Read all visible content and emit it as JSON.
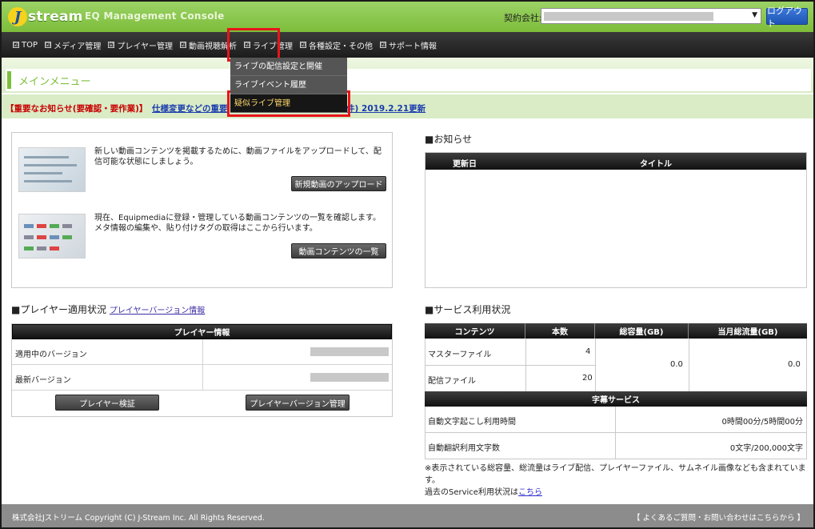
{
  "header": {
    "logo_text": "stream",
    "logo_mark": "J",
    "app_title": "EQ Management Console",
    "contract_label": "契約会社:",
    "contract_arrow": "▼",
    "logout_label": "ログアウト"
  },
  "nav": {
    "items": [
      {
        "label": "TOP"
      },
      {
        "label": "メディア管理"
      },
      {
        "label": "プレイヤー管理"
      },
      {
        "label": "動画視聴解析"
      },
      {
        "label": "ライブ管理"
      },
      {
        "label": "各種設定・その他"
      },
      {
        "label": "サポート情報"
      }
    ],
    "checkbox_glyph": "☑"
  },
  "dropdown": {
    "items": [
      {
        "label": "ライブの配信設定と開催"
      },
      {
        "label": "ライブイベント履歴"
      },
      {
        "label": "疑似ライブ管理"
      }
    ]
  },
  "page": {
    "title": "メインメニュー"
  },
  "notice": {
    "label": "【重要なお知らせ(要確認・要作業)】",
    "link": "仕様変更などの重要",
    "link_tail": "ます。(6件) 2019.2.21更新"
  },
  "upload": {
    "text1": "新しい動画コンテンツを掲載するために、動画ファイルをアップロードして、配信可能な状態にしましょう。",
    "button1": "新規動画のアップロード",
    "text2": "現在、Equipmediaに登録・管理している動画コンテンツの一覧を確認します。メタ情報の編集や、貼り付けタグの取得はここから行います。",
    "button2": "動画コンテンツの一覧"
  },
  "player": {
    "heading": "■プレイヤー適用状況",
    "heading_link": "プレイヤーバージョン情報",
    "table_head": "プレイヤー情報",
    "row1": "適用中のバージョン",
    "row2": "最新バージョン",
    "verify_button": "プレイヤー検証",
    "manage_button": "プレイヤーバージョン管理"
  },
  "news": {
    "heading": "■お知らせ",
    "col_date": "更新日",
    "col_title": "タイトル"
  },
  "service": {
    "heading": "■サービス利用状況",
    "cols": [
      "コンテンツ",
      "本数",
      "総容量(GB)",
      "当月総流量(GB)"
    ],
    "rows": [
      {
        "label": "マスターファイル",
        "count": "4"
      },
      {
        "label": "配信ファイル",
        "count": "20"
      }
    ],
    "total_capacity": "0.0",
    "monthly_traffic": "0.0",
    "caption_head": "字幕サービス",
    "caption_rows": [
      {
        "label": "自動文字起こし利用時間",
        "value": "0時間00分/5時間00分"
      },
      {
        "label": "自動翻訳利用文字数",
        "value": "0文字/200,000文字"
      }
    ],
    "note1": "※表示されている総容量、総流量はライブ配信、プレイヤーファイル、サムネイル画像なども含まれています。",
    "note2": "過去のService利用状況は",
    "note_link": "こちら"
  },
  "footer": {
    "copyright": "株式会社Jストリーム  Copyright (C) J-Stream Inc. All Rights Reserved.",
    "help": "【 よくあるご質問・お問い合わせはこちらから 】"
  }
}
